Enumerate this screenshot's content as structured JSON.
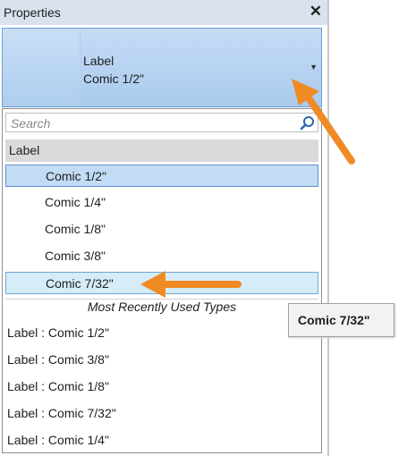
{
  "panel": {
    "title": "Properties",
    "close_icon": "close-icon"
  },
  "type_selector": {
    "line1": "Label",
    "line2": "Comic 1/2\""
  },
  "search": {
    "placeholder": "Search",
    "icon": "search-icon"
  },
  "group": {
    "label": "Label"
  },
  "options": [
    {
      "label": "Comic 1/2\"",
      "state": "selected"
    },
    {
      "label": "Comic 1/4\"",
      "state": "normal"
    },
    {
      "label": "Comic 1/8\"",
      "state": "normal"
    },
    {
      "label": "Comic 3/8\"",
      "state": "normal"
    },
    {
      "label": "Comic 7/32\"",
      "state": "hover"
    }
  ],
  "mru": {
    "header": "Most Recently Used Types",
    "items": [
      "Label : Comic 1/2\"",
      "Label : Comic 3/8\"",
      "Label : Comic 1/8\"",
      "Label : Comic 7/32\"",
      "Label : Comic 1/4\""
    ]
  },
  "tooltip": {
    "text": "Comic 7/32\""
  },
  "colors": {
    "accent_arrow": "#f08a24",
    "selection": "#c3dcf6",
    "hover": "#d6ecf8"
  }
}
